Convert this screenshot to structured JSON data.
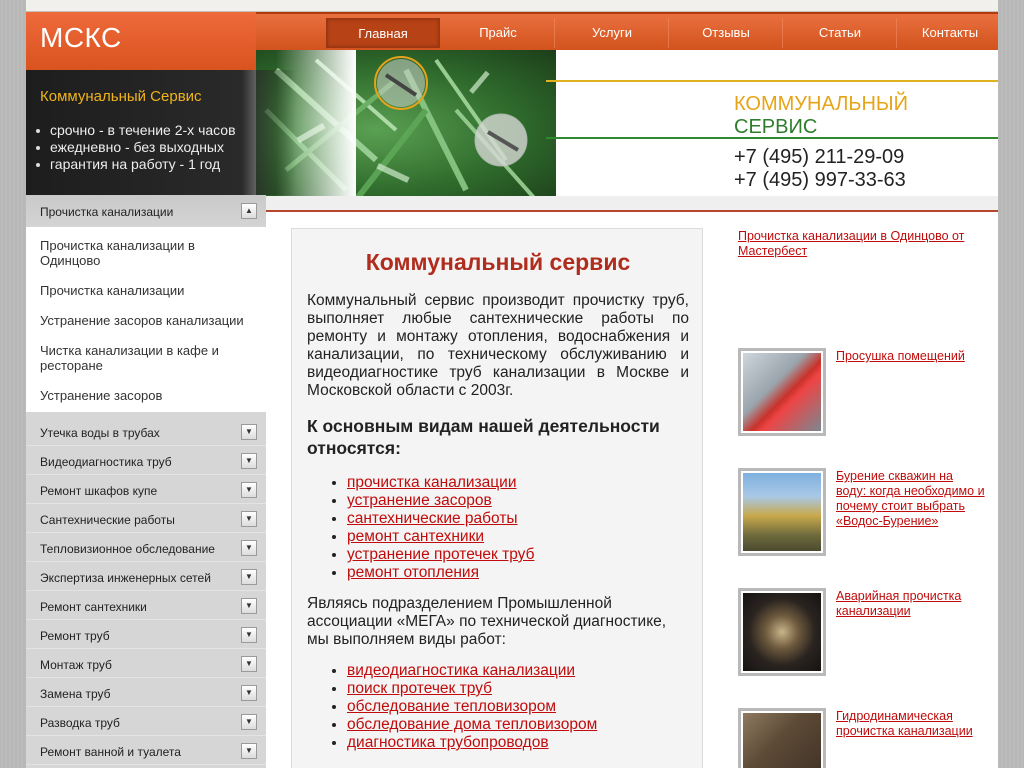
{
  "site": {
    "logo_text": "МСКС",
    "nav": [
      "Главная",
      "Прайс",
      "Услуги",
      "Отзывы",
      "Статьи",
      "Контакты"
    ],
    "active_nav": "Главная"
  },
  "promo": {
    "title": "Коммунальный Сервис",
    "bullets": [
      "срочно - в течение 2-х часов",
      "ежедневно - без выходных",
      "гарантия на работу - 1 год"
    ]
  },
  "brand": {
    "line1": "КОММУНАЛЬНЫЙ",
    "line2": "СЕРВИС",
    "phone1": "+7 (495) 211-29-09",
    "phone2": "+7 (495) 997-33-63"
  },
  "sidebar": {
    "header": "Прочистка канализации",
    "header_icon": "arrow-up-icon",
    "subitems": [
      "Прочистка канализации в Одинцово",
      "Прочистка канализации",
      "Устранение засоров канализации",
      "Чистка канализации в кафе и ресторане",
      "Устранение засоров"
    ],
    "categories": [
      "Утечка воды в трубах",
      "Видеодиагностика труб",
      "Ремонт шкафов купе",
      "Сантехнические работы",
      "Тепловизионное обследование",
      "Экспертиза инженерных сетей",
      "Ремонт сантехники",
      "Ремонт труб",
      "Монтаж труб",
      "Замена труб",
      "Разводка труб",
      "Ремонт ванной и туалета"
    ],
    "category_icon": "arrow-down-icon"
  },
  "main": {
    "title": "Коммунальный сервис",
    "intro": "Коммунальный сервис производит прочистку труб, выполняет любые сантехнические работы по ремонту и монтажу отопления, водоснабжения и канализации, по техническому обслуживанию и видеодиагностике труб канализации в Москве и Московской области с 2003г.",
    "subtitle": "К основным видам нашей деятельности относятся:",
    "activities": [
      "прочистка канализации",
      "устранение засоров",
      "сантехнические работы",
      "ремонт сантехники",
      "устранение протечек труб",
      "ремонт отопления"
    ],
    "para2": "Являясь подразделением Промышленной ассоциации «МЕГА» по технической диагностике, мы выполняем виды работ:",
    "works": [
      "видеодиагностика канализации",
      "поиск протечек труб",
      "обследование тепловизором",
      "обследование дома тепловизором",
      "диагностика трубопроводов"
    ]
  },
  "right": {
    "top_link": "Прочистка канализации в Одинцово от Мастербест",
    "articles": [
      "Просушка помещений",
      "Бурение скважин на воду: когда необходимо и почему стоит выбрать «Водос-Бурение»",
      "Аварийная прочистка канализации",
      "Гидродинамическая прочистка канализации"
    ]
  }
}
